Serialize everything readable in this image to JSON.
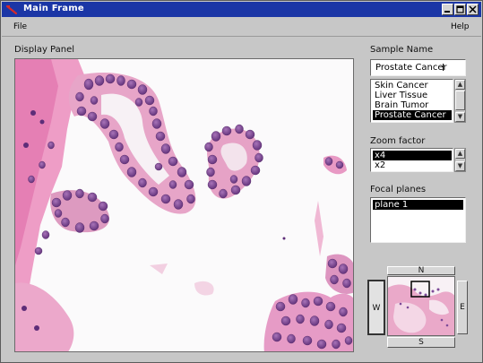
{
  "window": {
    "title": "Main Frame",
    "title_bar_color": "#1b36a6",
    "controls": [
      "minimize",
      "maximize",
      "close"
    ]
  },
  "menubar": {
    "items": [
      "File",
      "Help"
    ]
  },
  "display_panel": {
    "label": "Display Panel"
  },
  "sample": {
    "label": "Sample Name",
    "value": "Prostate Cancer",
    "options": [
      "Skin Cancer",
      "Liver Tissue",
      "Brain Tumor",
      "Prostate Cancer"
    ],
    "selected": "Prostate Cancer"
  },
  "zoom": {
    "label": "Zoom factor",
    "options": [
      "x4",
      "x2"
    ],
    "selected": "x4"
  },
  "focal": {
    "label": "Focal planes",
    "options": [
      "plane 1"
    ],
    "selected": "plane 1"
  },
  "navigator": {
    "north": "N",
    "south": "S",
    "east": "E",
    "west": "W",
    "active": "W"
  },
  "colors": {
    "selection_bg": "#000000",
    "tissue_pink": "#e79ac0",
    "nuclei_purple": "#7a3f93"
  }
}
